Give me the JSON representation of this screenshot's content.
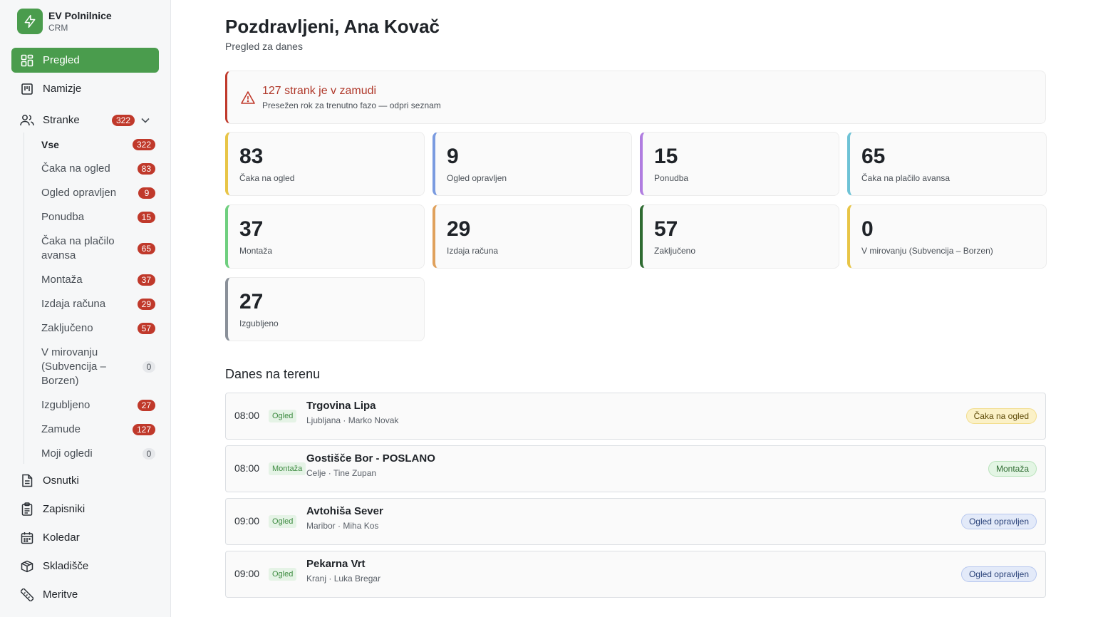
{
  "brand": {
    "title": "EV Polnilnice",
    "subtitle": "CRM",
    "logo_icon": "lightning-icon",
    "color": "#4a9c4d"
  },
  "nav": {
    "overview": "Pregled",
    "desks": "Namizje",
    "clients": {
      "label": "Stranke",
      "count": "322"
    },
    "drafts": "Osnutki",
    "notes": "Zapisniki",
    "calendar": "Koledar",
    "warehouse": "Skladišče",
    "measurements": "Meritve"
  },
  "sub_items": [
    {
      "label": "Vse",
      "count": "322"
    },
    {
      "label": "Čaka na ogled",
      "count": "83"
    },
    {
      "label": "Ogled opravljen",
      "count": "9"
    },
    {
      "label": "Ponudba",
      "count": "15"
    },
    {
      "label": "Čaka na plačilo avansa",
      "count": "65"
    },
    {
      "label": "Montaža",
      "count": "37"
    },
    {
      "label": "Izdaja računa",
      "count": "29"
    },
    {
      "label": "Zaključeno",
      "count": "57"
    },
    {
      "label": "V mirovanju (Subvencija – Borzen)",
      "count": "0"
    },
    {
      "label": "Izgubljeno",
      "count": "27"
    },
    {
      "label": "Zamude",
      "count": "127"
    },
    {
      "label": "Moji ogledi",
      "count": "0"
    }
  ],
  "header": {
    "greeting": "Pozdravljeni, Ana Kovač",
    "subtitle": "Pregled za danes"
  },
  "alert": {
    "title": "127 strank je v zamudi",
    "subtitle": "Presežen rok za trenutno fazo — odpri seznam",
    "color": "#c0392b"
  },
  "stats": [
    {
      "value": "83",
      "label": "Čaka na ogled",
      "color": "#e8c547"
    },
    {
      "value": "9",
      "label": "Ogled opravljen",
      "color": "#7a9be0"
    },
    {
      "value": "15",
      "label": "Ponudba",
      "color": "#b07de0"
    },
    {
      "value": "65",
      "label": "Čaka na plačilo avansa",
      "color": "#6fc3d6"
    },
    {
      "value": "37",
      "label": "Montaža",
      "color": "#6fcf7f"
    },
    {
      "value": "29",
      "label": "Izdaja računa",
      "color": "#e0a15c"
    },
    {
      "value": "57",
      "label": "Zaključeno",
      "color": "#2e6b31"
    },
    {
      "value": "0",
      "label": "V mirovanju (Subvencija – Borzen)",
      "color": "#e8c547"
    },
    {
      "value": "27",
      "label": "Izgubljeno",
      "color": "#8a9099"
    }
  ],
  "field_section": {
    "title": "Danes na terenu",
    "rows": [
      {
        "time": "08:00",
        "type": "Ogled",
        "name": "Trgovina Lipa",
        "city": "Ljubljana",
        "person": "Marko Novak",
        "status": "Čaka na ogled",
        "status_color": "yellow"
      },
      {
        "time": "08:00",
        "type": "Montaža",
        "name": "Gostišče Bor - POSLANO",
        "city": "Celje",
        "person": "Tine Zupan",
        "status": "Montaža",
        "status_color": "green"
      },
      {
        "time": "09:00",
        "type": "Ogled",
        "name": "Avtohiša Sever",
        "city": "Maribor",
        "person": "Miha Kos",
        "status": "Ogled opravljen",
        "status_color": "blue"
      },
      {
        "time": "09:00",
        "type": "Ogled",
        "name": "Pekarna Vrt",
        "city": "Kranj",
        "person": "Luka Bregar",
        "status": "Ogled opravljen",
        "status_color": "blue"
      }
    ]
  }
}
